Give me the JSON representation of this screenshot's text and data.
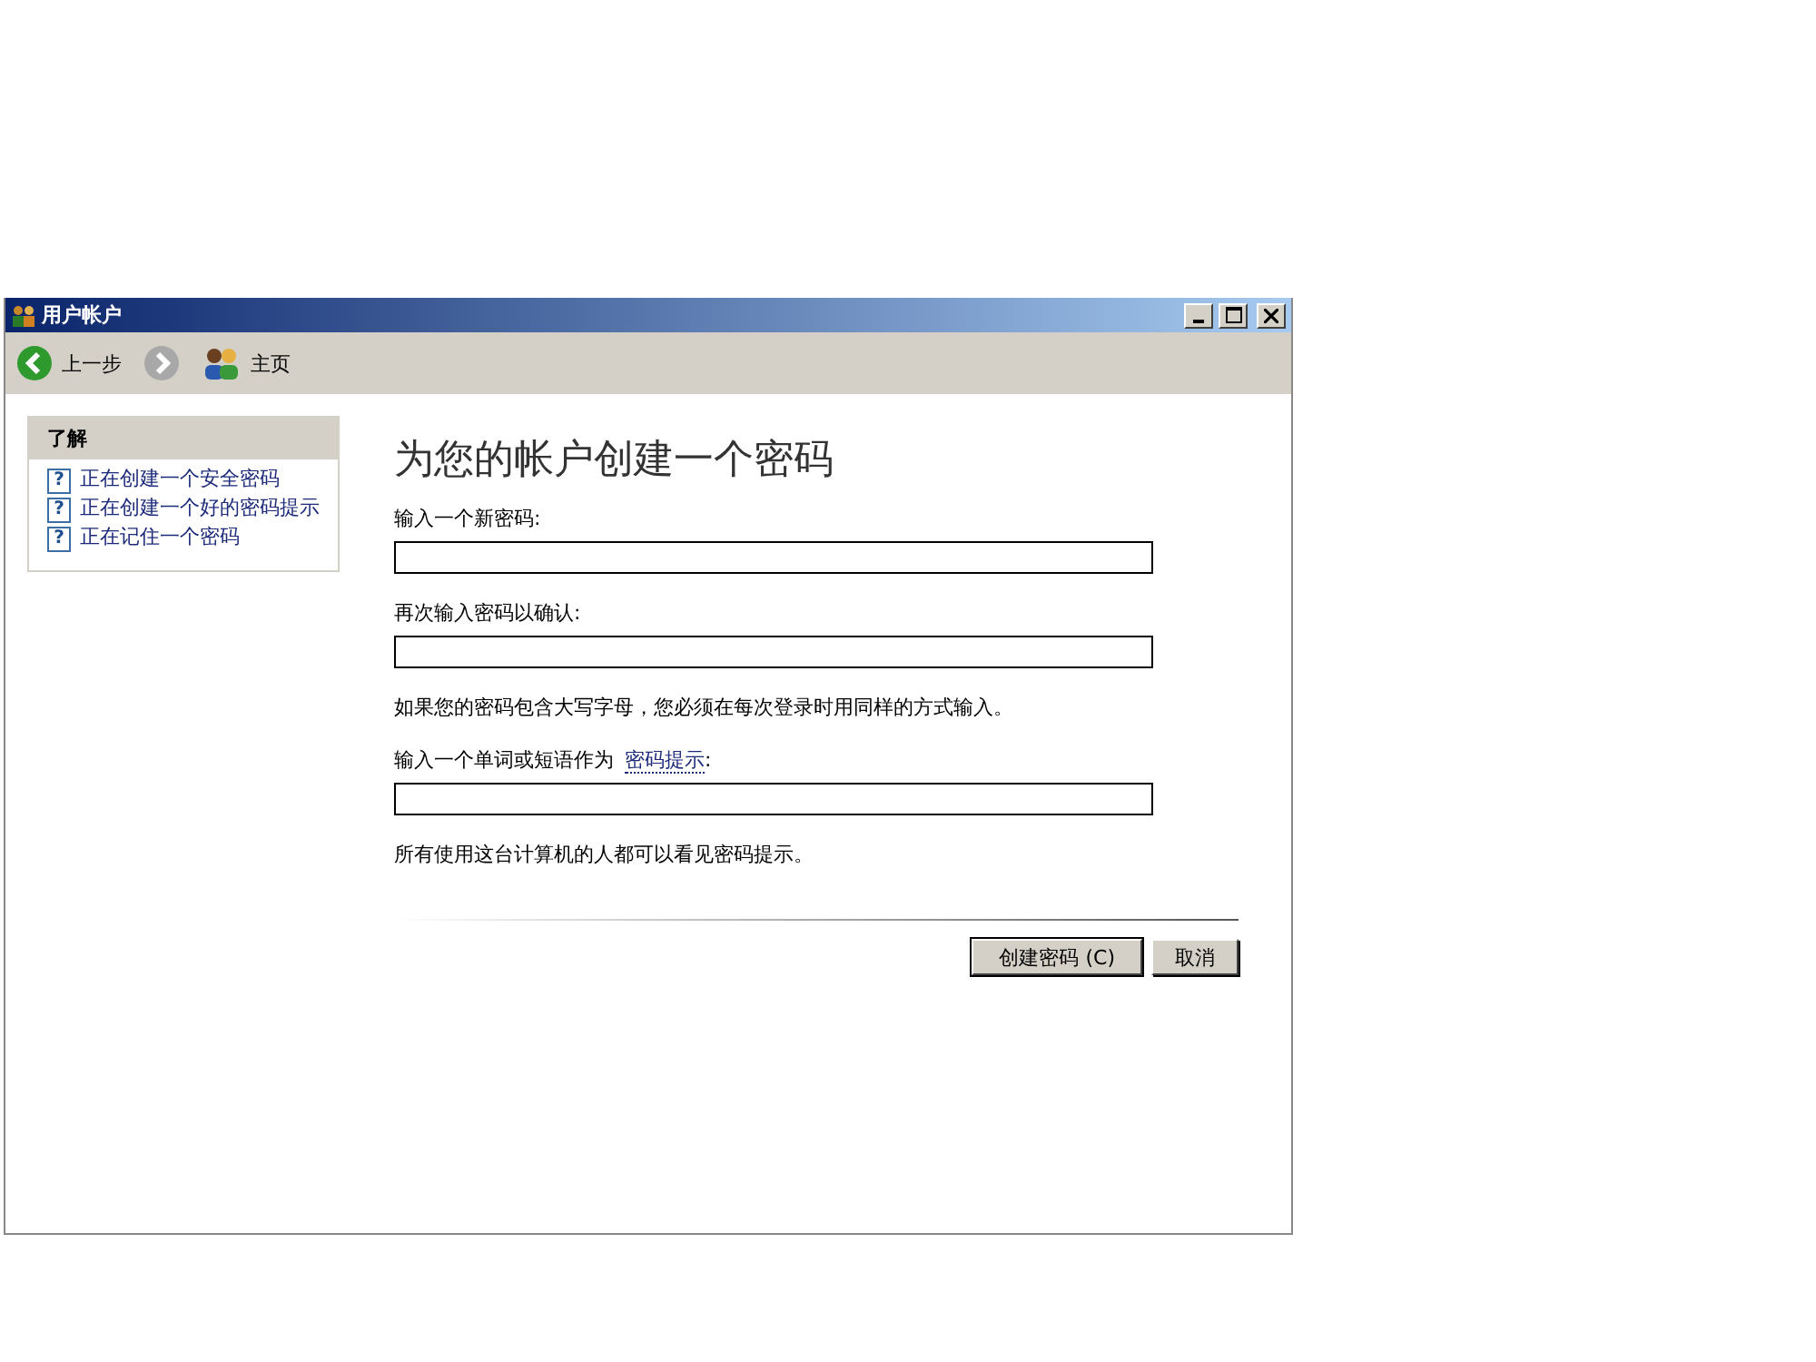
{
  "window": {
    "title": "用户帐户"
  },
  "toolbar": {
    "back": "上一步",
    "home": "主页"
  },
  "sidebar": {
    "title": "了解",
    "items": [
      {
        "icon": "?",
        "label": "正在创建一个安全密码"
      },
      {
        "icon": "?",
        "label": "正在创建一个好的密码提示"
      },
      {
        "icon": "?",
        "label": "正在记住一个密码"
      }
    ]
  },
  "main": {
    "heading": "为您的帐户创建一个密码",
    "new_password_label": "输入一个新密码:",
    "confirm_label": "再次输入密码以确认:",
    "case_note": "如果您的密码包含大写字母，您必须在每次登录时用同样的方式输入。",
    "hint_label": {
      "text": "输入一个单词或短语作为",
      "link": "密码提示",
      "suffix": ":"
    },
    "hint_note": "所有使用这台计算机的人都可以看见密码提示。"
  },
  "buttons": [
    {
      "label": "创建密码 (C)"
    },
    {
      "label": "取消"
    }
  ]
}
